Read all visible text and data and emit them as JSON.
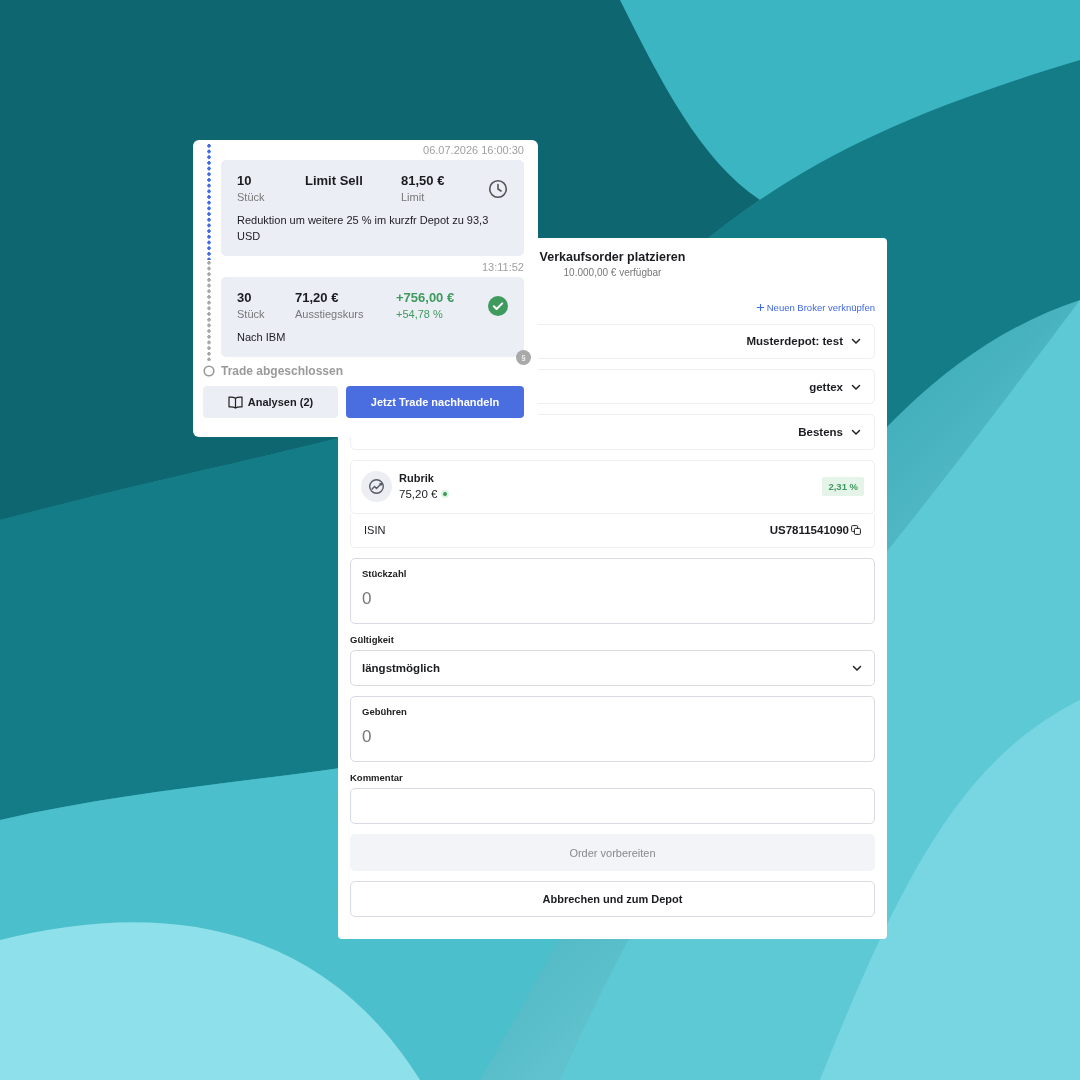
{
  "timeline": {
    "entries": [
      {
        "kind": "order",
        "timestamp": "06.07.2026 16:00:30",
        "completed": false,
        "quantity": "10",
        "quantity_label": "Stück",
        "type": "Limit Sell",
        "price": "81,50 €",
        "price_label": "Limit",
        "note": "Reduktion um weitere 25 % im kurzfr Depot zu 93,3 USD"
      },
      {
        "kind": "exit",
        "timestamp": "13:11:52",
        "completed": true,
        "quantity": "30",
        "quantity_label": "Stück",
        "price": "71,20 €",
        "price_label": "Ausstiegskurs",
        "profit": "+756,00 €",
        "profit_percent": "+54,78 %",
        "note": "Nach IBM",
        "badge": "§"
      }
    ],
    "end_label": "Trade abgeschlossen",
    "buttons": [
      {
        "kind": "secondary",
        "label": "Analysen (2)"
      },
      {
        "kind": "primary",
        "label": "Jetzt Trade nachhandeln"
      }
    ]
  },
  "order_form": {
    "title": "Verkaufsorder platzieren",
    "subtitle": "10.000,00 € verfügbar",
    "link": "Neuen Broker verknüpfen",
    "selects": [
      {
        "value": "Musterdepot: test"
      },
      {
        "value": "gettex"
      },
      {
        "value": "Bestens"
      }
    ],
    "instrument": {
      "name": "Rubrik",
      "price": "75,20 €",
      "change": "2,31 %"
    },
    "isin": {
      "label": "ISIN",
      "value": "US7811541090"
    },
    "fields": [
      {
        "kind": "input",
        "label": "Stückzahl",
        "placeholder": "0"
      },
      {
        "kind": "select",
        "label": "Gültigkeit",
        "value": "längstmöglich"
      },
      {
        "kind": "input",
        "label": "Gebühren",
        "placeholder": "0"
      },
      {
        "kind": "textarea",
        "label": "Kommentar"
      }
    ],
    "buttons": [
      {
        "label": "Order vorbereiten",
        "disabled": true
      },
      {
        "label": "Abbrechen und zum Depot",
        "disabled": false
      }
    ]
  }
}
